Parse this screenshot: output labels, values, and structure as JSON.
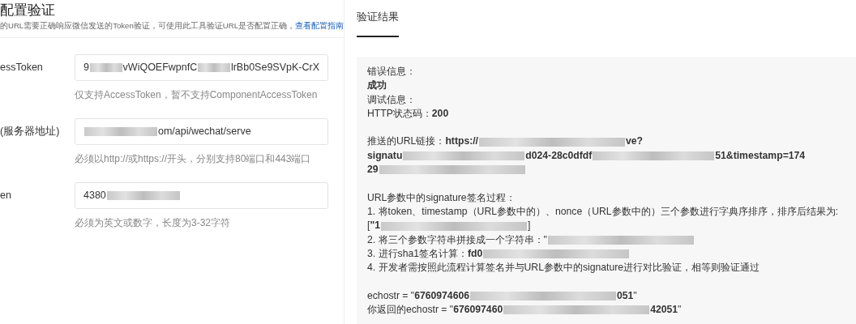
{
  "config_panel": {
    "title": "配置验证",
    "description": "的URL需要正确响应微信发送的Token验证，可使用此工具验证URL是否配置正确，",
    "guide_link": "查看配置指南",
    "fields": [
      {
        "label": "essToken",
        "value_parts": [
          {
            "kind": "text",
            "text": "9"
          },
          {
            "kind": "redacted"
          },
          {
            "kind": "text",
            "text": "vWiQOEFwpnfC"
          },
          {
            "kind": "redacted"
          },
          {
            "kind": "text",
            "text": "lrBb0Se9SVpK-CrX"
          }
        ],
        "hint": "仅支持AccessToken，暂不支持ComponentAccessToken"
      },
      {
        "label": "(服务器地址)",
        "value_parts": [
          {
            "kind": "redacted"
          },
          {
            "kind": "text",
            "text": "om/api/wechat/serve"
          }
        ],
        "hint": "必须以http://或https://开头，分别支持80端口和443端口"
      },
      {
        "label": "en",
        "value_parts": [
          {
            "kind": "text",
            "text": "4380"
          },
          {
            "kind": "redacted"
          }
        ],
        "hint": "必须为英文或数字，长度为3-32字符"
      }
    ]
  },
  "result_panel": {
    "tabs": [
      {
        "label": "验证结果",
        "selected": true
      }
    ],
    "lines": [
      {
        "kind": "text",
        "parts": [
          {
            "kind": "text",
            "text": "错误信息："
          }
        ]
      },
      {
        "kind": "text",
        "parts": [
          {
            "kind": "text",
            "text": "**成功**"
          }
        ]
      },
      {
        "kind": "text",
        "parts": [
          {
            "kind": "text",
            "text": "调试信息："
          }
        ]
      },
      {
        "kind": "text",
        "parts": [
          {
            "kind": "text",
            "text": "HTTP状态码：**200**"
          }
        ]
      },
      {
        "kind": "blank"
      },
      {
        "kind": "text",
        "parts": [
          {
            "kind": "text",
            "text": "推送的URL链接：**https://**"
          },
          {
            "kind": "redacted"
          },
          {
            "kind": "text",
            "text": "**ve?**"
          }
        ]
      },
      {
        "kind": "text",
        "parts": [
          {
            "kind": "text",
            "text": "**signatu**"
          },
          {
            "kind": "redacted"
          },
          {
            "kind": "text",
            "text": "**d024-28c0dfdf**"
          },
          {
            "kind": "redacted"
          },
          {
            "kind": "text",
            "text": "**51&timestamp=174**"
          }
        ]
      },
      {
        "kind": "text",
        "parts": [
          {
            "kind": "text",
            "text": "**29**"
          },
          {
            "kind": "redacted"
          }
        ]
      },
      {
        "kind": "blank"
      },
      {
        "kind": "text",
        "parts": [
          {
            "kind": "text",
            "text": "URL参数中的signature签名过程："
          }
        ]
      },
      {
        "kind": "text",
        "parts": [
          {
            "kind": "text",
            "text": "1. 将token、timestamp（URL参数中的）、nonce（URL参数中的）三个参数进行字典序排序，排序后结果为:"
          }
        ]
      },
      {
        "kind": "text",
        "parts": [
          {
            "kind": "text",
            "text": "[**\"1**"
          },
          {
            "kind": "redacted"
          },
          {
            "kind": "text",
            "text": "]"
          }
        ]
      },
      {
        "kind": "text",
        "parts": [
          {
            "kind": "text",
            "text": "2. 将三个参数字符串拼接成一个字符串：\""
          },
          {
            "kind": "redacted"
          }
        ]
      },
      {
        "kind": "text",
        "parts": [
          {
            "kind": "text",
            "text": "3. 进行sha1签名计算：**fd0**"
          },
          {
            "kind": "redacted"
          }
        ]
      },
      {
        "kind": "text",
        "parts": [
          {
            "kind": "text",
            "text": "4. 开发者需按照此流程计算签名并与URL参数中的signature进行对比验证，相等则验证通过"
          }
        ]
      },
      {
        "kind": "blank"
      },
      {
        "kind": "text",
        "parts": [
          {
            "kind": "text",
            "text": "echostr = \"**6760974606**"
          },
          {
            "kind": "redacted"
          },
          {
            "kind": "text",
            "text": "**051**\""
          }
        ]
      },
      {
        "kind": "text",
        "parts": [
          {
            "kind": "text",
            "text": "你返回的echostr = \"**676097460**"
          },
          {
            "kind": "redacted"
          },
          {
            "kind": "text",
            "text": "**42051**\""
          }
        ]
      }
    ]
  }
}
